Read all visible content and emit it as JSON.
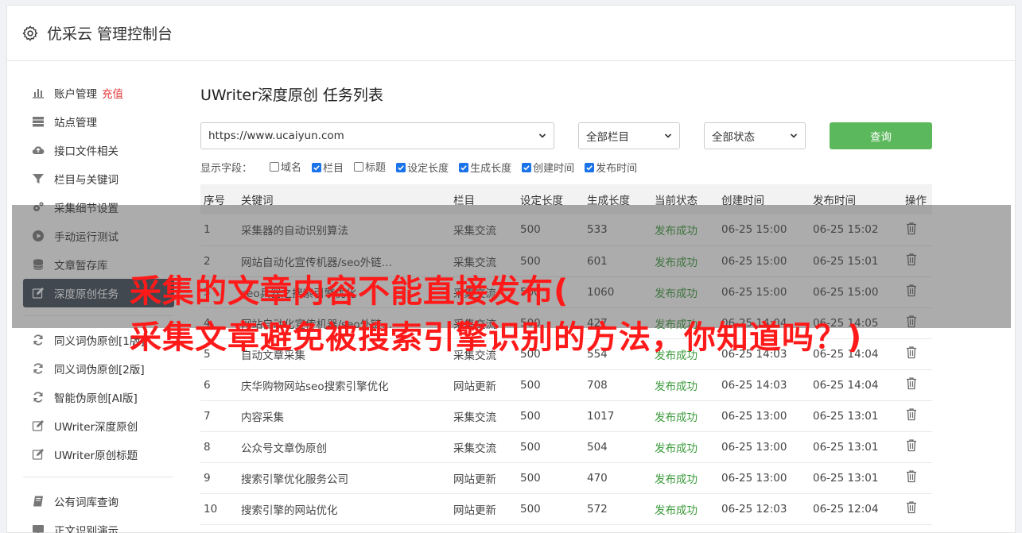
{
  "app": {
    "title": "优采云 管理控制台"
  },
  "sidebar": {
    "items": [
      {
        "label": "账户管理",
        "icon": "bar-chart-icon",
        "extra": "充值"
      },
      {
        "label": "站点管理",
        "icon": "server-icon"
      },
      {
        "label": "接口文件相关",
        "icon": "cloud-upload-icon"
      },
      {
        "label": "栏目与关键词",
        "icon": "filter-icon"
      },
      {
        "label": "采集细节设置",
        "icon": "cogs-icon"
      },
      {
        "label": "手动运行测试",
        "icon": "play-circle-icon"
      },
      {
        "label": "文章暂存库",
        "icon": "database-icon"
      },
      {
        "label": "深度原创任务",
        "icon": "edit-icon",
        "active": true
      }
    ],
    "items2": [
      {
        "label": "同义词伪原创[1版]",
        "icon": "refresh-icon"
      },
      {
        "label": "同义词伪原创[2版]",
        "icon": "refresh-icon"
      },
      {
        "label": "智能伪原创[AI版]",
        "icon": "refresh-icon"
      },
      {
        "label": "UWriter深度原创",
        "icon": "edit-icon"
      },
      {
        "label": "UWriter原创标题",
        "icon": "edit-icon"
      }
    ],
    "items3": [
      {
        "label": "公有词库查询",
        "icon": "book-icon"
      },
      {
        "label": "正文识别演示",
        "icon": "monitor-icon"
      }
    ]
  },
  "main": {
    "page_title": "UWriter深度原创 任务列表",
    "filters": {
      "site": "https://www.ucaiyun.com",
      "column": "全部栏目",
      "status": "全部状态",
      "query_label": "查询"
    },
    "fields_label": "显示字段：",
    "fields": [
      {
        "label": "域名",
        "checked": false
      },
      {
        "label": "栏目",
        "checked": true
      },
      {
        "label": "标题",
        "checked": false
      },
      {
        "label": "设定长度",
        "checked": true
      },
      {
        "label": "生成长度",
        "checked": true
      },
      {
        "label": "创建时间",
        "checked": true
      },
      {
        "label": "发布时间",
        "checked": true
      }
    ],
    "table": {
      "headers": [
        "序号",
        "关键词",
        "栏目",
        "设定长度",
        "生成长度",
        "当前状态",
        "创建时间",
        "发布时间",
        "操作"
      ],
      "rows": [
        [
          "1",
          "采集器的自动识别算法",
          "采集交流",
          "500",
          "533",
          "发布成功",
          "06-25 15:00",
          "06-25 15:02"
        ],
        [
          "2",
          "网站自动化宣传机器/seo外链…",
          "采集交流",
          "500",
          "601",
          "发布成功",
          "06-25 15:00",
          "06-25 15:01"
        ],
        [
          "3",
          "seo兵器之搜索引擎优化",
          "采集交流",
          "500",
          "1060",
          "发布成功",
          "06-25 15:00",
          "06-25 15:00"
        ],
        [
          "4",
          "网站自动化宣传机器/seo外链…",
          "采集交流",
          "500",
          "427",
          "发布成功",
          "06-25 14:04",
          "06-25 14:05"
        ],
        [
          "5",
          "自动文章采集",
          "采集交流",
          "500",
          "554",
          "发布成功",
          "06-25 14:03",
          "06-25 14:04"
        ],
        [
          "6",
          "庆华购物网站seo搜索引擎优化",
          "网站更新",
          "500",
          "708",
          "发布成功",
          "06-25 14:03",
          "06-25 14:04"
        ],
        [
          "7",
          "内容采集",
          "采集交流",
          "500",
          "1017",
          "发布成功",
          "06-25 13:00",
          "06-25 13:01"
        ],
        [
          "8",
          "公众号文章伪原创",
          "采集交流",
          "500",
          "504",
          "发布成功",
          "06-25 13:00",
          "06-25 13:01"
        ],
        [
          "9",
          "搜索引擎优化服务公司",
          "网站更新",
          "500",
          "470",
          "发布成功",
          "06-25 13:00",
          "06-25 13:01"
        ],
        [
          "10",
          "搜索引擎的网站优化",
          "网站更新",
          "500",
          "572",
          "发布成功",
          "06-25 12:03",
          "06-25 12:04"
        ]
      ]
    }
  },
  "overlay": {
    "line1": "采集的文章内容不能直接发布(",
    "line2": "采集文章避免被搜索引擎识别的方法，你知道吗？)",
    "color": "#ff1a1a"
  }
}
